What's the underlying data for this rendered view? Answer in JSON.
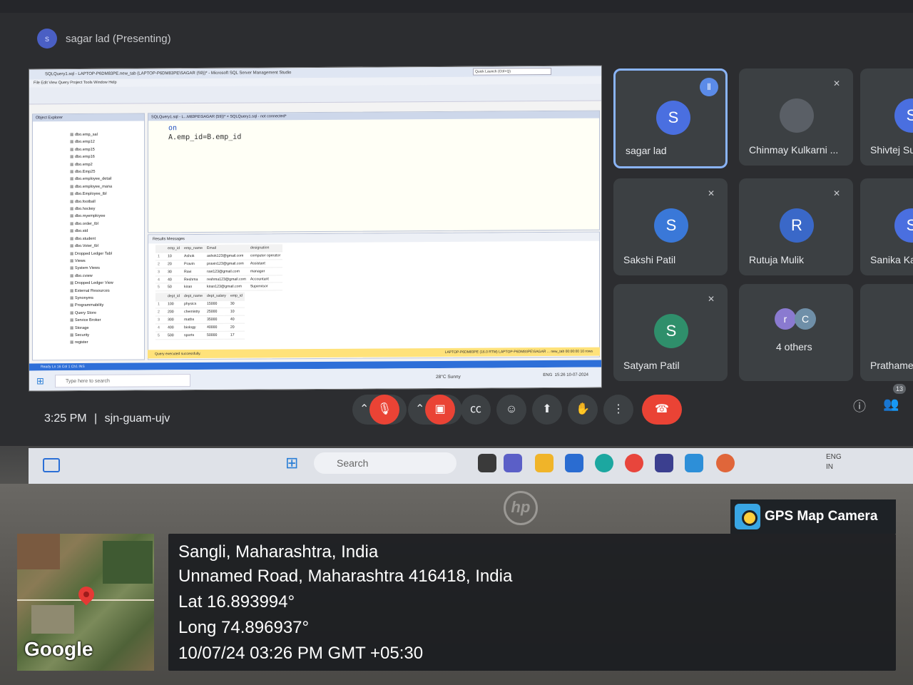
{
  "meet": {
    "presenter_initial": "s",
    "presenter_label": "sagar lad (Presenting)",
    "meeting_time": "3:25 PM",
    "separator": "|",
    "meeting_code": "sjn-guam-ujv",
    "participant_count": "13"
  },
  "participants": [
    {
      "name": "sagar lad",
      "initial": "S",
      "color": "#4a6fe0",
      "speaking": true
    },
    {
      "name": "Chinmay Kulkarni ...",
      "initial": "",
      "color": "#666b72",
      "muted": true
    },
    {
      "name": "Shivtej Sul",
      "initial": "S",
      "color": "#4a6fe0"
    },
    {
      "name": "Sakshi Patil",
      "initial": "S",
      "color": "#3a78d8",
      "muted": true
    },
    {
      "name": "Rutuja Mulik",
      "initial": "R",
      "color": "#3a68c8",
      "muted": true
    },
    {
      "name": "Sanika Kar",
      "initial": "S",
      "color": "#4a6fe0"
    },
    {
      "name": "Satyam Patil",
      "initial": "S",
      "color": "#2f8f6b",
      "muted": true
    },
    {
      "name": "4 others",
      "initial": "r",
      "initial2": "C"
    },
    {
      "name": "Prathame",
      "initial": ""
    }
  ],
  "ssms": {
    "title": "SQLQuery1.sql - LAPTOP-P6DM83PE.new_tab (LAPTOP-P6DM83PE\\SAGAR (59))* - Microsoft SQL Server Management Studio",
    "quick_launch": "Quick Launch (Ctrl+Q)",
    "menu": "File   Edit   View   Query   Project   Tools   Window   Help",
    "object_explorer": "Object Explorer",
    "tree": [
      "dbo.emp_sal",
      "dbo.emp12",
      "dbo.emp15",
      "dbo.emp16",
      "dbo.emp2",
      "dbo.Emp25",
      "dbo.employee_detail",
      "dbo.employee_mana",
      "dbo.Employee_tbl",
      "dbo.football",
      "dbo.hockey",
      "dbo.myemployee",
      "dbo.order_tbl",
      "dbo.std",
      "dbo.student",
      "dbo.Voter_tbl",
      "Dropped Ledger Tabl",
      "Views",
      "System Views",
      "dbo.cview",
      "Dropped Ledger View",
      "External Resources",
      "Synonyms",
      "Programmability",
      "Query Store",
      "Service Broker",
      "Storage",
      "Security",
      "register"
    ],
    "tabs": "SQLQuery1.sql - L...M83PE\\SAGAR (59))*   ×    SQLQuery1.sql - not connected*",
    "code_line1": "on",
    "code_line2": "A.emp_id=B.emp_id",
    "results_tabs": "Results    Messages",
    "grid1_header": [
      "emp_id",
      "emp_name",
      "Email",
      "designation"
    ],
    "grid1": [
      [
        "1",
        "10",
        "Ashok",
        "ashok123@gmail.com",
        "computer operator"
      ],
      [
        "2",
        "20",
        "Pravin",
        "pravin123@gmail.com",
        "Assistant"
      ],
      [
        "3",
        "30",
        "Ravi",
        "ravi123@gmail.com",
        "manager"
      ],
      [
        "4",
        "40",
        "Reshma",
        "reshma123@gmail.com",
        "Accountant"
      ],
      [
        "5",
        "50",
        "kiran",
        "kiran123@gmail.com",
        "Supervisor"
      ]
    ],
    "grid2_header": [
      "dept_id",
      "dept_name",
      "dept_salary",
      "emp_id"
    ],
    "grid2": [
      [
        "1",
        "100",
        "physics",
        "15000",
        "30"
      ],
      [
        "2",
        "200",
        "chemistry",
        "25000",
        "10"
      ],
      [
        "3",
        "300",
        "maths",
        "35000",
        "40"
      ],
      [
        "4",
        "400",
        "biology",
        "40000",
        "20"
      ],
      [
        "5",
        "500",
        "sports",
        "50000",
        "17"
      ]
    ],
    "status_ok": "Query executed successfully.",
    "status_right": "LAPTOP-P6DM83PE (16.0 RTM)   LAPTOP-P6DM83PE\\SAGAR ...   new_tab   00:00:00   10 rows",
    "status_bar": "Ready                                                                    Ln 16        Col 1        Ch1        INS",
    "zoom": "100 %",
    "search_placeholder": "Type here to search",
    "weather": "28°C  Sunny",
    "lang": "ENG",
    "clock_time": "15:26",
    "clock_date": "10-07-2024"
  },
  "taskbar": {
    "search_placeholder": "Search",
    "lang": "ENG",
    "region": "IN"
  },
  "laptop_brand": "hp",
  "gps": {
    "app_name": "GPS Map Camera",
    "city": "Sangli, Maharashtra, India",
    "address": "Unnamed Road, Maharashtra 416418, India",
    "lat": "Lat 16.893994°",
    "long": "Long 74.896937°",
    "datetime": "10/07/24 03:26 PM GMT +05:30",
    "map_brand": "Google"
  }
}
